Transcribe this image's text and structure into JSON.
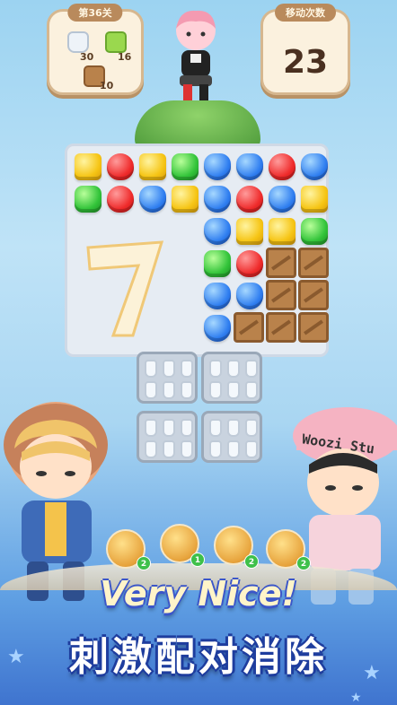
{
  "hud": {
    "level_label": "第36关",
    "goals": [
      {
        "name": "jar",
        "count": "30"
      },
      {
        "name": "green-block",
        "count": "16"
      },
      {
        "name": "crate",
        "count": "10"
      }
    ],
    "moves_label": "移动次数",
    "moves_value": "23"
  },
  "combo": {
    "number": "7"
  },
  "characters": {
    "right_hat_text": "Woozi Stu"
  },
  "boosters": [
    {
      "name": "bomb-booster",
      "count": "2"
    },
    {
      "name": "rocket-booster",
      "count": "1"
    },
    {
      "name": "pinwheel-booster",
      "count": "2"
    },
    {
      "name": "magnet-booster",
      "count": "2"
    }
  ],
  "slogan": {
    "english": "Very Nice!",
    "chinese": "刺激配对消除"
  },
  "colors": {
    "panel_bg": "#fbf1de",
    "panel_tab": "#b98a5c",
    "slogan_outline": "#1e3d9e",
    "gem_yellow": "#f6c515",
    "gem_red": "#ef2b2b",
    "gem_green": "#33c43a",
    "gem_blue": "#2f7ef0"
  },
  "board": {
    "rows": [
      [
        "yellow",
        "red",
        "yellow",
        "green",
        "blue",
        "blue",
        "red",
        "blue"
      ],
      [
        "green",
        "red",
        "blue",
        "yellow",
        "blue",
        "red",
        "blue",
        "yellow"
      ],
      [
        "",
        "",
        "",
        "",
        "blue",
        "yellow",
        "yellow",
        "green"
      ],
      [
        "",
        "",
        "",
        "",
        "green",
        "red",
        "crate",
        "crate"
      ],
      [
        "",
        "",
        "",
        "",
        "blue",
        "blue",
        "crate",
        "crate"
      ],
      [
        "",
        "",
        "",
        "",
        "blue",
        "crate",
        "crate",
        "crate"
      ]
    ]
  }
}
